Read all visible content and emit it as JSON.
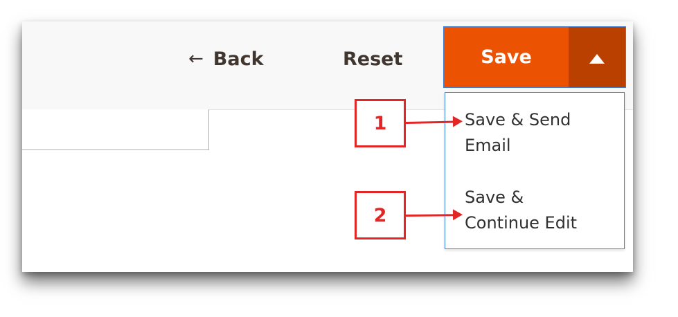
{
  "toolbar": {
    "back_label": "Back",
    "back_icon": "arrow-left-icon",
    "reset_label": "Reset",
    "save_label": "Save",
    "save_toggle_icon": "caret-up-icon",
    "save_color": "#eb5202",
    "save_toggle_color": "#ba4000"
  },
  "save_menu": {
    "items": [
      {
        "label": "Save & Send\nEmail"
      },
      {
        "label": "Save &\nContinue Edit"
      }
    ]
  },
  "callouts": [
    {
      "number": "1"
    },
    {
      "number": "2"
    }
  ],
  "annotation_color": "#e22626"
}
